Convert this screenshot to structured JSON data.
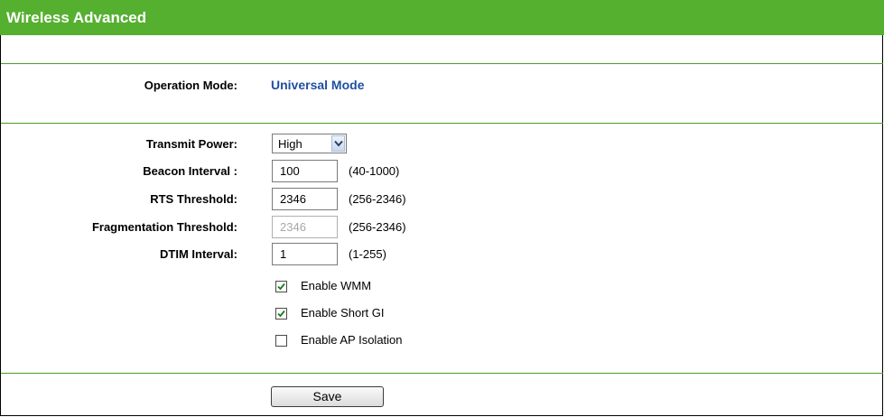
{
  "header": {
    "title": "Wireless Advanced"
  },
  "operation": {
    "label": "Operation Mode:",
    "value": "Universal Mode"
  },
  "form": {
    "transmit_power": {
      "label": "Transmit Power:",
      "selected": "High"
    },
    "beacon_interval": {
      "label": "Beacon Interval :",
      "value": "100",
      "range": "(40-1000)"
    },
    "rts_threshold": {
      "label": "RTS Threshold:",
      "value": "2346",
      "range": "(256-2346)"
    },
    "fragmentation_threshold": {
      "label": "Fragmentation Threshold:",
      "value": "2346",
      "range": "(256-2346)",
      "disabled": true
    },
    "dtim_interval": {
      "label": "DTIM Interval:",
      "value": "1",
      "range": "(1-255)"
    }
  },
  "options": {
    "wmm": {
      "label": "Enable WMM",
      "checked": true
    },
    "short_gi": {
      "label": "Enable Short GI",
      "checked": true
    },
    "ap_isolation": {
      "label": "Enable AP Isolation",
      "checked": false
    }
  },
  "actions": {
    "save_label": "Save"
  },
  "colors": {
    "header_bg": "#55b030",
    "divider": "#4a9a2a",
    "mode_text": "#1f4f9f"
  }
}
